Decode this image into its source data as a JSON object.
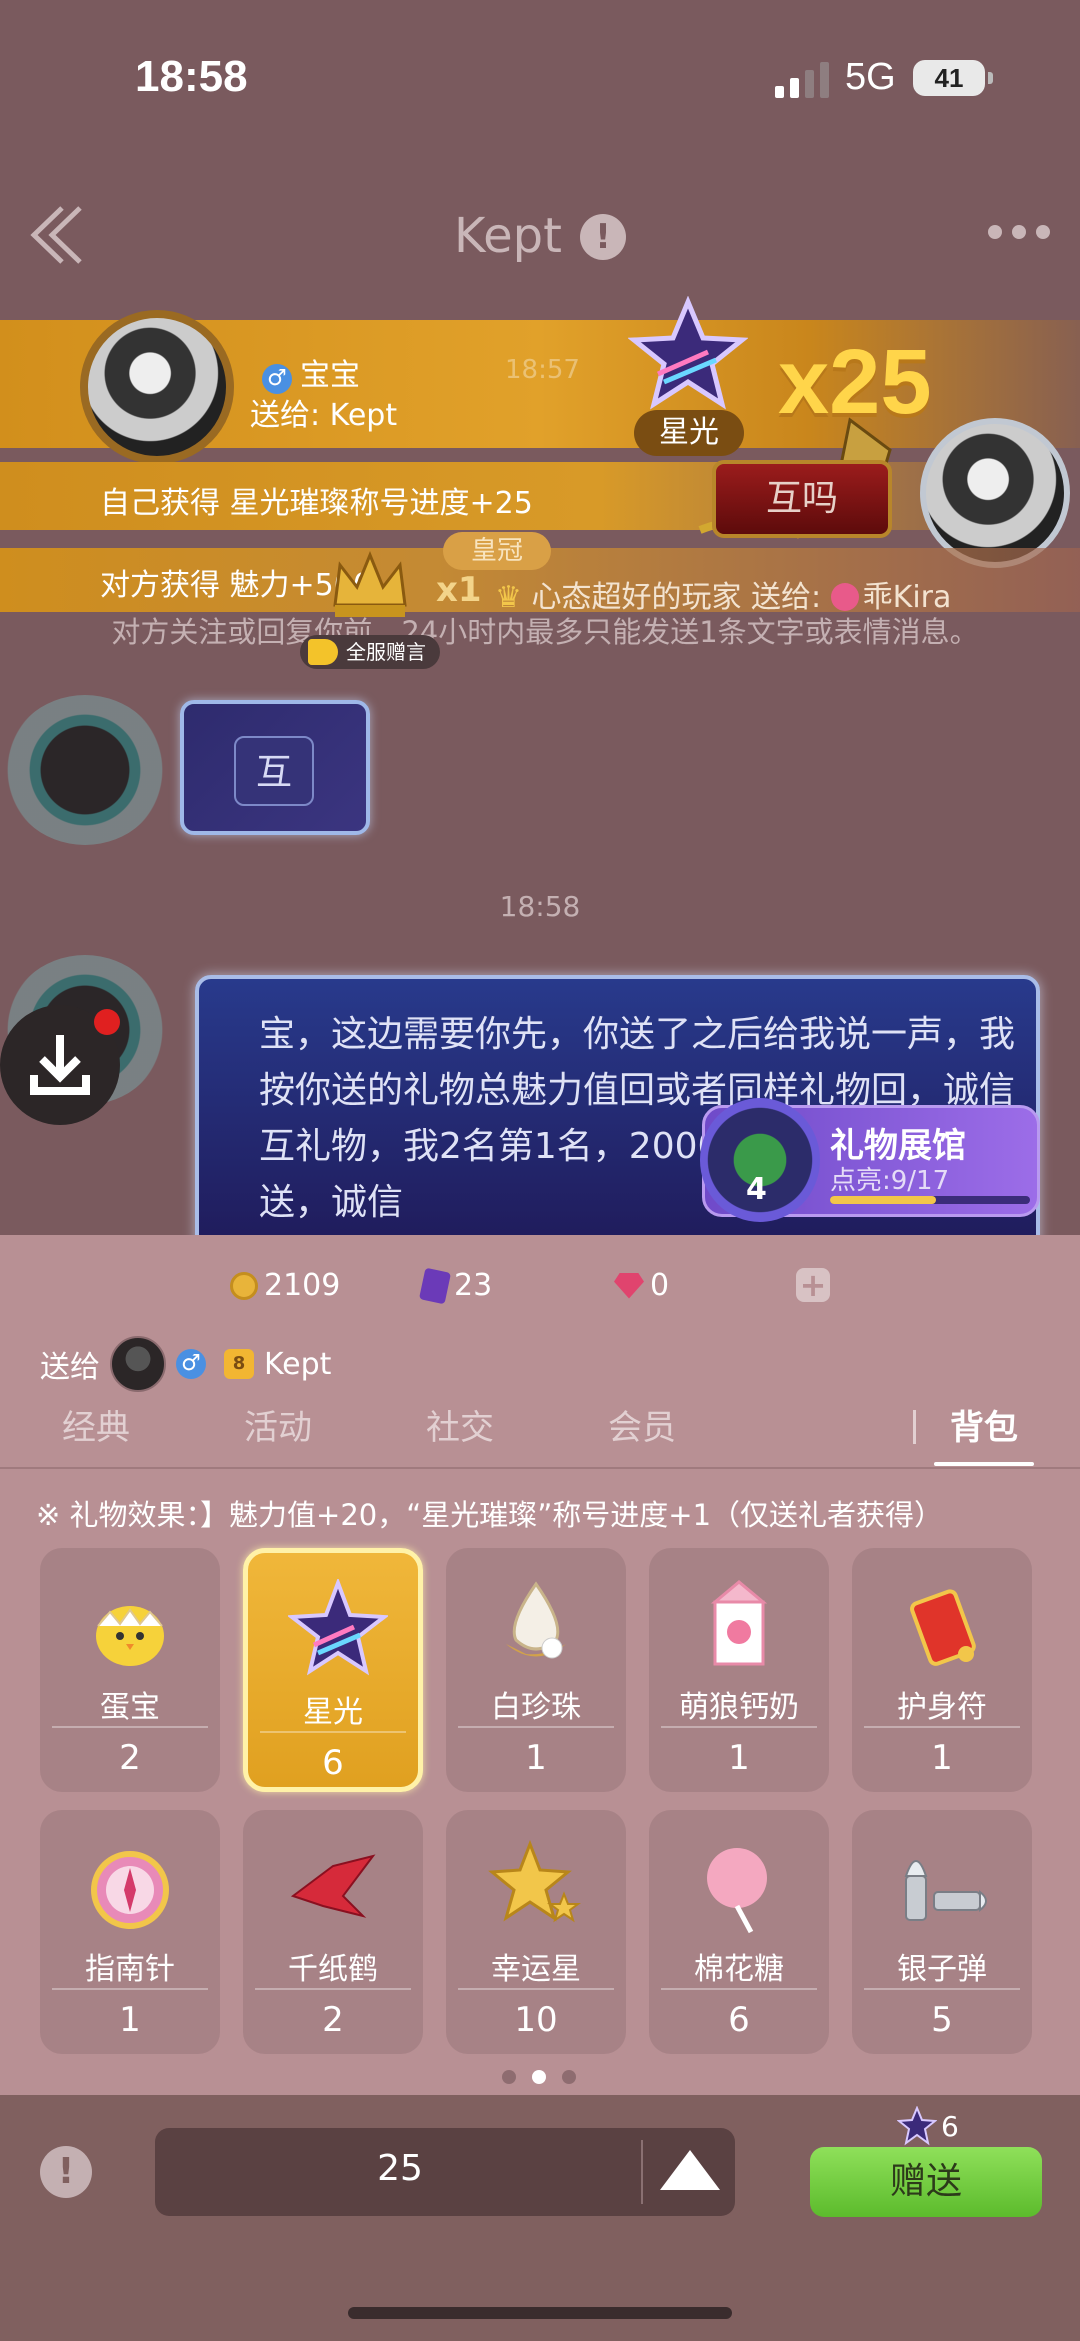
{
  "status": {
    "time": "18:58",
    "network": "5G",
    "battery": "41"
  },
  "nav": {
    "title": "Kept"
  },
  "banner": {
    "sender": "宝宝",
    "to": "送给: Kept",
    "gift_label": "星光",
    "multiplier": "x25",
    "ghost_time": "18:57",
    "self_gain": "自己获得   星光璀璨称号进度+25",
    "other_gain": "对方获得   魅力+500",
    "button_huma": "互吗",
    "crown_tag": "皇冠",
    "x1": "x1",
    "broadcast_text": "心态超好的玩家  送给:",
    "broadcast_target": "乖Kira",
    "announce": "全服赠言"
  },
  "chat": {
    "system_msg": "对方关注或回复你前，24小时内最多只能发送1条文字或表情消息。",
    "bubble_small": "互",
    "timestamp": "18:58",
    "message": "宝，这边需要你先，你送了之后给我说一声，我按你送的礼物总魅力值回或者同样礼物回，诚信互礼物，我2名第1名，2000万魅力值。放心送，诚信"
  },
  "gallery": {
    "title": "礼物展馆",
    "level": "4",
    "progress": "点亮:9/17",
    "progress_ratio": 0.53
  },
  "wallet": {
    "coins": "2109",
    "cards": "23",
    "gems": "0"
  },
  "send_to": {
    "label": "送给",
    "vip": "8",
    "name": "Kept"
  },
  "tabs": [
    "经典",
    "活动",
    "社交",
    "会员",
    "背包"
  ],
  "effect": "※ 礼物效果：】魅力值+20，“星光璀璨”称号进度+1（仅送礼者获得）",
  "items": [
    {
      "name": "蛋宝",
      "count": "2",
      "icon": "egg-chick-icon"
    },
    {
      "name": "星光",
      "count": "6",
      "icon": "star-icon"
    },
    {
      "name": "白珍珠",
      "count": "1",
      "icon": "pearl-icon"
    },
    {
      "name": "萌狼钙奶",
      "count": "1",
      "icon": "milk-icon"
    },
    {
      "name": "护身符",
      "count": "1",
      "icon": "amulet-icon"
    },
    {
      "name": "指南针",
      "count": "1",
      "icon": "compass-icon"
    },
    {
      "name": "千纸鹤",
      "count": "2",
      "icon": "paper-crane-icon"
    },
    {
      "name": "幸运星",
      "count": "10",
      "icon": "lucky-star-icon"
    },
    {
      "name": "棉花糖",
      "count": "6",
      "icon": "cotton-candy-icon"
    },
    {
      "name": "银子弹",
      "count": "5",
      "icon": "silver-bullet-icon"
    }
  ],
  "bottom": {
    "quantity": "25",
    "send_count": "6",
    "send_label": "赠送"
  }
}
